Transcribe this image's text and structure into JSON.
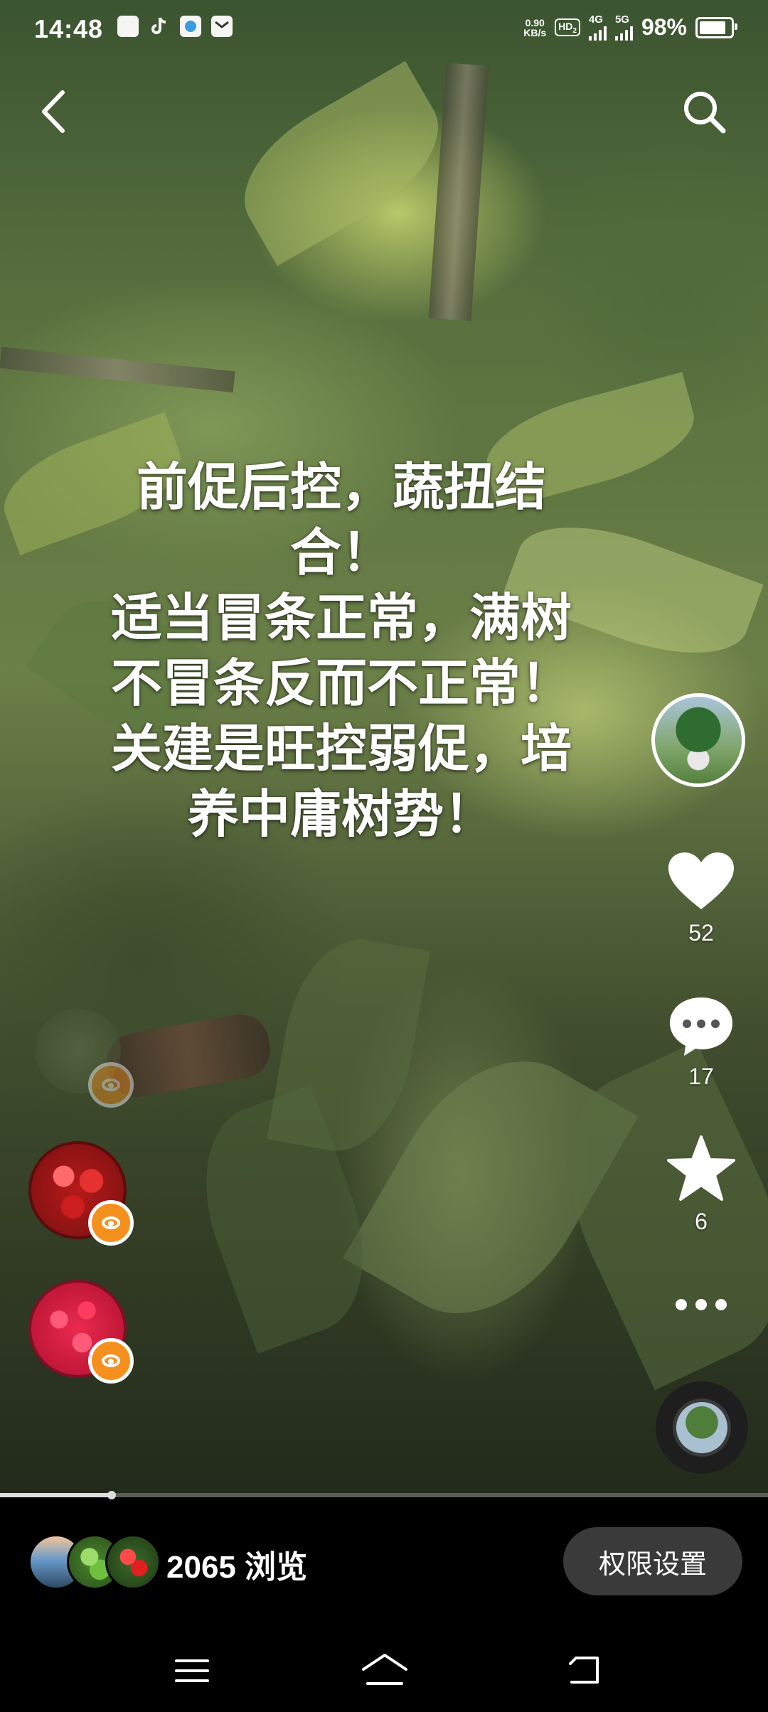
{
  "status_bar": {
    "time": "14:48",
    "net_speed_value": "0.90",
    "net_speed_unit": "KB/s",
    "hd_label": "HD",
    "hd_sub": "2",
    "sim1_label": "4G",
    "sim2_label": "5G",
    "battery": "98%",
    "left_icons": [
      "wechat-icon",
      "tiktok-icon",
      "app-icon",
      "message-icon"
    ]
  },
  "top_bar": {
    "back_icon": "chevron-left-icon",
    "search_icon": "search-icon"
  },
  "caption_lines": [
    "前促后控，蔬扭结",
    "合！",
    "适当冒条正常，满树",
    "不冒条反而不正常！",
    "关建是旺控弱促，培",
    "养中庸树势！"
  ],
  "actions": {
    "like_count": "52",
    "comment_count": "17",
    "favorite_count": "6"
  },
  "playback": {
    "progress_fraction": 0.145
  },
  "bottom": {
    "views_text": "2065 浏览",
    "permission_button": "权限设置"
  },
  "nav": {
    "icons": [
      "menu-icon",
      "home-icon",
      "back-icon"
    ]
  },
  "colors": {
    "badge_orange": "#f5901e",
    "button_bg": "#3a3a3a"
  }
}
